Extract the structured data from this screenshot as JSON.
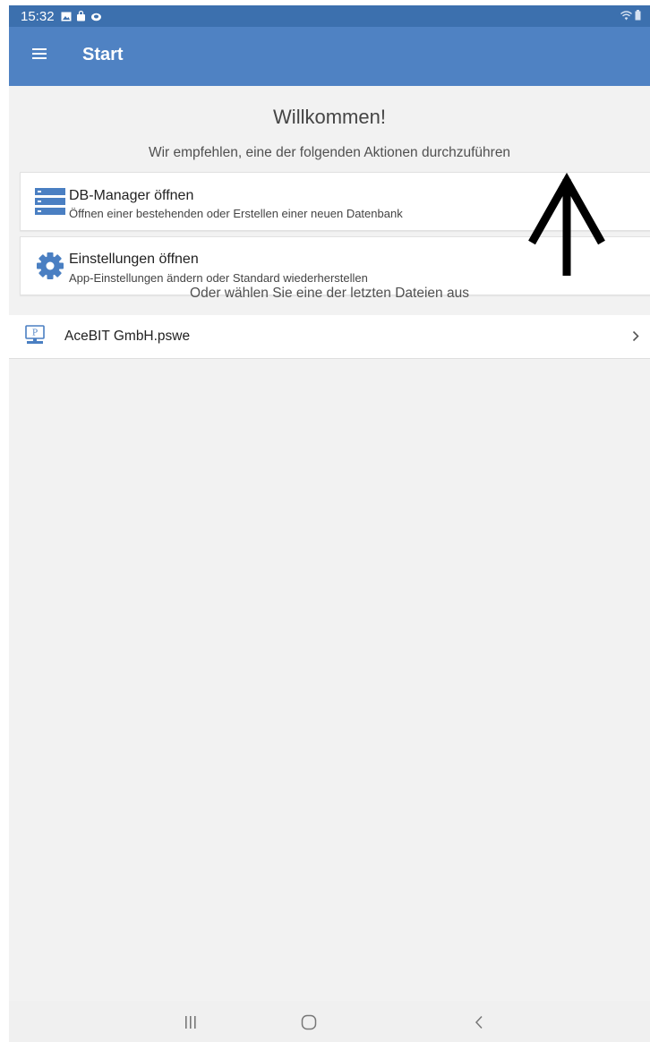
{
  "status_bar": {
    "time": "15:32",
    "icons": [
      "gallery-icon",
      "shopping-bag-icon",
      "cloud-icon",
      "wifi-icon",
      "battery-icon"
    ]
  },
  "app_bar": {
    "title": "Start",
    "menu_icon": "hamburger-menu-icon"
  },
  "welcome": {
    "title": "Willkommen!",
    "subtitle": "Wir empfehlen, eine der folgenden Aktionen durchzuführen"
  },
  "actions": [
    {
      "icon": "database-icon",
      "title": "DB-Manager öffnen",
      "description": "Öffnen einer bestehenden oder Erstellen einer neuen Datenbank"
    },
    {
      "icon": "gear-icon",
      "title": "Einstellungen öffnen",
      "description": "App-Einstellungen ändern oder Standard wiederherstellen"
    }
  ],
  "recent": {
    "heading": "Oder wählen Sie eine der letzten Dateien aus",
    "files": [
      {
        "icon": "pswe-file-icon",
        "name": "AceBIT GmbH.pswe"
      }
    ]
  },
  "nav_bar": {
    "buttons": [
      "recents-icon",
      "home-icon",
      "back-icon"
    ]
  },
  "colors": {
    "status_bar": "#3c70ae",
    "app_bar": "#4f82c3",
    "accent_icon": "#4a7fc2",
    "background": "#f2f2f2"
  }
}
